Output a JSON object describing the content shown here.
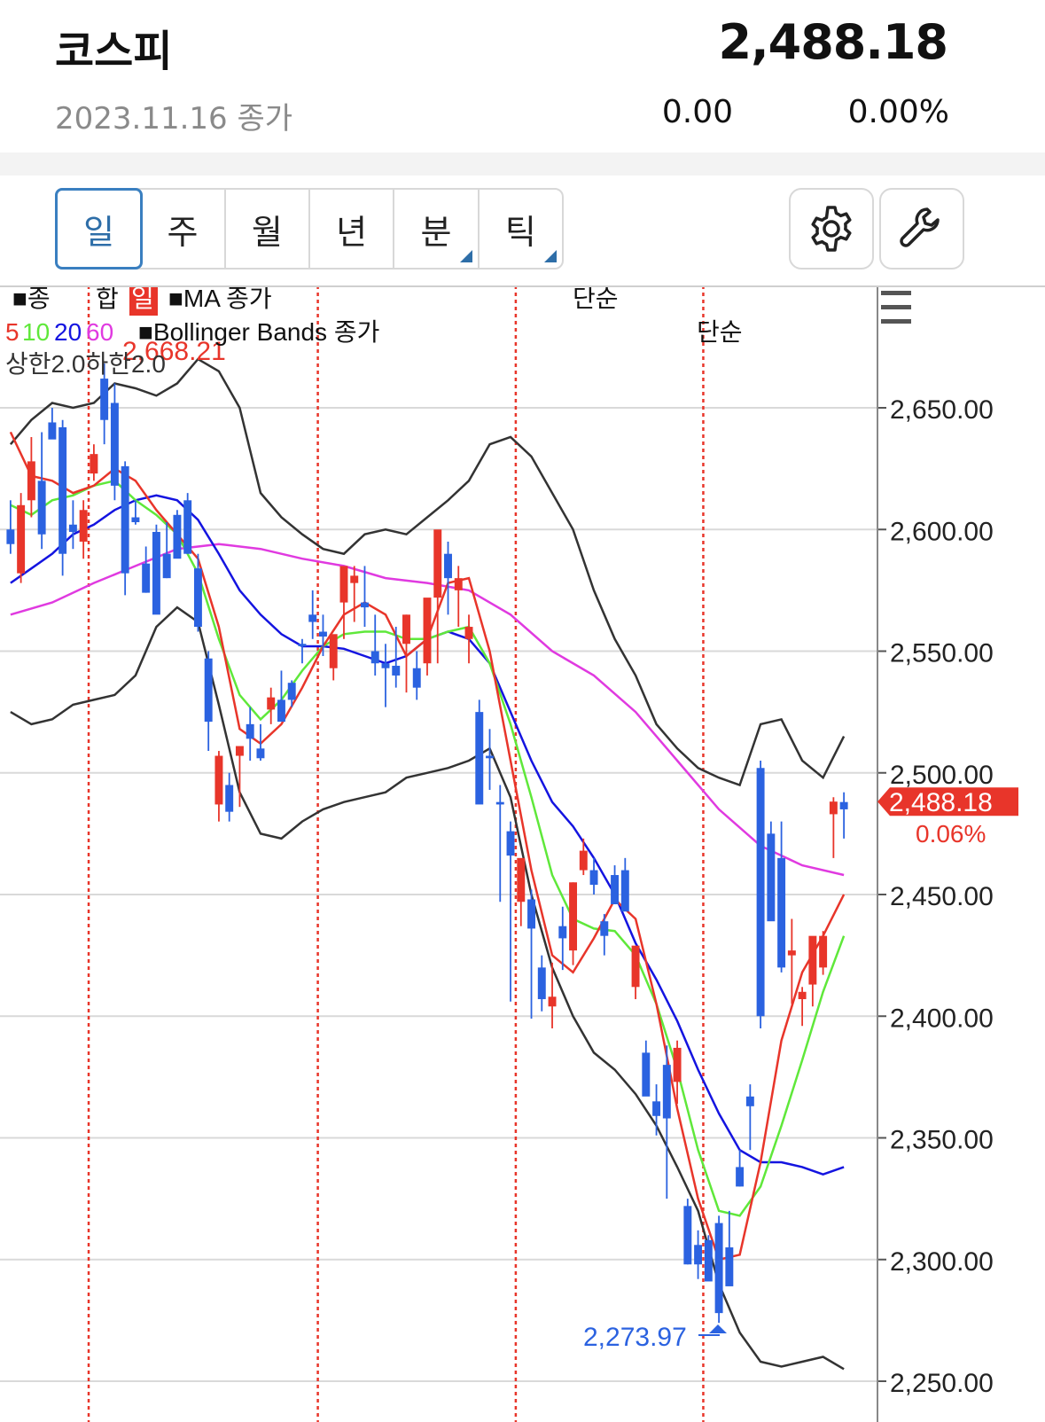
{
  "header": {
    "title": "코스피",
    "price": "2,488.18",
    "date_label": "2023.11.16 종가",
    "change": "0.00",
    "change_pct": "0.00%"
  },
  "period_tabs": [
    {
      "label": "일",
      "active": true,
      "has_submenu": false
    },
    {
      "label": "주",
      "active": false,
      "has_submenu": false
    },
    {
      "label": "월",
      "active": false,
      "has_submenu": false
    },
    {
      "label": "년",
      "active": false,
      "has_submenu": false
    },
    {
      "label": "분",
      "active": false,
      "has_submenu": true
    },
    {
      "label": "틱",
      "active": false,
      "has_submenu": true
    }
  ],
  "tools": {
    "settings_icon": "gear-icon",
    "tools_icon": "wrench-icon",
    "menu_icon": "hamburger-icon"
  },
  "legend": {
    "main_prefix": "■종",
    "main_mid": "합",
    "main_badge": "일",
    "ma_label": "■MA 종가",
    "ma_type": "단순",
    "ma_periods": [
      {
        "label": "5",
        "color": "#e8352a"
      },
      {
        "label": "10",
        "color": "#5fe83a"
      },
      {
        "label": "20",
        "color": "#1414e0"
      },
      {
        "label": "60",
        "color": "#e03ae0"
      }
    ],
    "bb_label": "■Bollinger Bands 종가",
    "bb_type": "단순",
    "bb_params": "상한2.0하한2.0"
  },
  "colors": {
    "up": "#e8352a",
    "down": "#2b62e0",
    "bb": "#333333",
    "ma5": "#e8352a",
    "ma10": "#5fe83a",
    "ma20": "#1414e0",
    "ma60": "#e03ae0",
    "separator": "#e8352a",
    "high_label": "#e8352a",
    "low_label": "#2b62e0"
  },
  "chart_data": {
    "type": "candlestick",
    "y_axis": {
      "min": 2250,
      "max": 2700,
      "ticks": [
        "2,650.00",
        "2,600.00",
        "2,550.00",
        "2,500.00",
        "2,450.00",
        "2,400.00",
        "2,350.00",
        "2,300.00",
        "2,250.00"
      ],
      "tick_values": [
        2650,
        2600,
        2550,
        2500,
        2450,
        2400,
        2350,
        2300,
        2250
      ]
    },
    "high_label": "2,668.21",
    "low_label": "2,273.97",
    "current_value": "2,488.18",
    "current_change_pct": "0.06%",
    "month_separators_after_index": [
      7,
      29,
      48,
      66
    ],
    "ohlc": [
      [
        2600,
        2612,
        2590,
        2594
      ],
      [
        2582,
        2615,
        2578,
        2610
      ],
      [
        2612,
        2638,
        2605,
        2628
      ],
      [
        2620,
        2640,
        2592,
        2598
      ],
      [
        2644,
        2650,
        2638,
        2637
      ],
      [
        2642,
        2645,
        2581,
        2590
      ],
      [
        2602,
        2612,
        2592,
        2599
      ],
      [
        2595,
        2612,
        2588,
        2608
      ],
      [
        2623,
        2635,
        2620,
        2631
      ],
      [
        2662,
        2668.21,
        2635,
        2645
      ],
      [
        2652,
        2660,
        2612,
        2618
      ],
      [
        2626,
        2628,
        2573,
        2582
      ],
      [
        2605,
        2612,
        2602,
        2603
      ],
      [
        2586,
        2593,
        2574,
        2574
      ],
      [
        2599,
        2602,
        2569,
        2565
      ],
      [
        2590,
        2603,
        2580,
        2580
      ],
      [
        2606,
        2608,
        2589,
        2588
      ],
      [
        2612,
        2615,
        2590,
        2590
      ],
      [
        2584,
        2590,
        2558,
        2560
      ],
      [
        2547,
        2550,
        2509,
        2521
      ],
      [
        2487,
        2509,
        2480,
        2507
      ],
      [
        2495,
        2500,
        2480,
        2484
      ],
      [
        2507,
        2510,
        2486,
        2511
      ],
      [
        2520,
        2527,
        2505,
        2514
      ],
      [
        2510,
        2520,
        2505,
        2506
      ],
      [
        2526,
        2535,
        2520,
        2531
      ],
      [
        2530,
        2542,
        2524,
        2521
      ],
      [
        2537,
        2538,
        2527,
        2530
      ],
      [
        2553,
        2555,
        2545,
        2552
      ],
      [
        2565,
        2575,
        2555,
        2562
      ],
      [
        2558,
        2565,
        2548,
        2556
      ],
      [
        2543,
        2555,
        2538,
        2557
      ],
      [
        2570,
        2580,
        2555,
        2585
      ],
      [
        2578,
        2585,
        2562,
        2581
      ],
      [
        2570,
        2585,
        2560,
        2568
      ],
      [
        2550,
        2565,
        2540,
        2545
      ],
      [
        2545,
        2553,
        2527,
        2543
      ],
      [
        2544,
        2560,
        2535,
        2540
      ],
      [
        2553,
        2565,
        2533,
        2565
      ],
      [
        2543,
        2550,
        2530,
        2535
      ],
      [
        2545,
        2565,
        2540,
        2572
      ],
      [
        2572,
        2582,
        2545,
        2600
      ],
      [
        2590,
        2595,
        2565,
        2580
      ],
      [
        2575,
        2585,
        2560,
        2580
      ],
      [
        2555,
        2565,
        2545,
        2560
      ],
      [
        2525,
        2530,
        2493,
        2487
      ],
      [
        2507,
        2518,
        2493,
        2506
      ],
      [
        2488,
        2495,
        2447,
        2487
      ],
      [
        2476,
        2480,
        2406,
        2466
      ],
      [
        2447,
        2460,
        2437,
        2465
      ],
      [
        2448,
        2452,
        2399,
        2436
      ],
      [
        2420,
        2425,
        2402,
        2407
      ],
      [
        2404,
        2422,
        2395,
        2408
      ],
      [
        2437,
        2445,
        2419,
        2432
      ],
      [
        2427,
        2455,
        2421,
        2455
      ],
      [
        2460,
        2473,
        2458,
        2468
      ],
      [
        2460,
        2465,
        2450,
        2454
      ],
      [
        2439,
        2442,
        2425,
        2433
      ],
      [
        2458,
        2462,
        2452,
        2446
      ],
      [
        2460,
        2465,
        2448,
        2443
      ],
      [
        2412,
        2425,
        2407,
        2429
      ],
      [
        2385,
        2390,
        2370,
        2367
      ],
      [
        2365,
        2372,
        2351,
        2359
      ],
      [
        2380,
        2388,
        2325,
        2358
      ],
      [
        2373,
        2390,
        2364,
        2387
      ],
      [
        2322,
        2325,
        2298,
        2298
      ],
      [
        2306,
        2312,
        2292,
        2298
      ],
      [
        2308,
        2310,
        2295,
        2291
      ],
      [
        2315,
        2318,
        2273.97,
        2278
      ],
      [
        2305,
        2320,
        2290,
        2289
      ],
      [
        2338,
        2345,
        2330,
        2330
      ],
      [
        2367,
        2372,
        2345,
        2363
      ],
      [
        2502,
        2505,
        2395,
        2400
      ],
      [
        2475,
        2480,
        2440,
        2439
      ],
      [
        2465,
        2480,
        2418,
        2420
      ],
      [
        2425,
        2440,
        2405,
        2427
      ],
      [
        2407,
        2412,
        2396,
        2410
      ],
      [
        2413,
        2420,
        2404,
        2433
      ],
      [
        2420,
        2435,
        2417,
        2433
      ],
      [
        2483,
        2490,
        2465,
        2488.18
      ],
      [
        2488,
        2492,
        2473,
        2485
      ]
    ],
    "ma5": [
      [
        0,
        2640
      ],
      [
        2,
        2622
      ],
      [
        4,
        2620
      ],
      [
        6,
        2615
      ],
      [
        8,
        2618
      ],
      [
        10,
        2625
      ],
      [
        12,
        2620
      ],
      [
        14,
        2608
      ],
      [
        16,
        2598
      ],
      [
        18,
        2588
      ],
      [
        20,
        2560
      ],
      [
        22,
        2518
      ],
      [
        24,
        2512
      ],
      [
        26,
        2520
      ],
      [
        28,
        2535
      ],
      [
        30,
        2552
      ],
      [
        32,
        2565
      ],
      [
        34,
        2570
      ],
      [
        36,
        2565
      ],
      [
        38,
        2548
      ],
      [
        40,
        2555
      ],
      [
        42,
        2578
      ],
      [
        44,
        2580
      ],
      [
        46,
        2550
      ],
      [
        48,
        2505
      ],
      [
        50,
        2460
      ],
      [
        52,
        2425
      ],
      [
        54,
        2418
      ],
      [
        56,
        2432
      ],
      [
        58,
        2448
      ],
      [
        60,
        2440
      ],
      [
        62,
        2405
      ],
      [
        64,
        2362
      ],
      [
        66,
        2325
      ],
      [
        68,
        2300
      ],
      [
        70,
        2302
      ],
      [
        72,
        2340
      ],
      [
        74,
        2390
      ],
      [
        76,
        2418
      ],
      [
        78,
        2433
      ],
      [
        80,
        2450
      ]
    ],
    "ma10": [
      [
        0,
        2610
      ],
      [
        2,
        2606
      ],
      [
        4,
        2612
      ],
      [
        6,
        2614
      ],
      [
        8,
        2618
      ],
      [
        10,
        2620
      ],
      [
        12,
        2612
      ],
      [
        14,
        2606
      ],
      [
        16,
        2598
      ],
      [
        18,
        2582
      ],
      [
        20,
        2555
      ],
      [
        22,
        2532
      ],
      [
        24,
        2522
      ],
      [
        26,
        2530
      ],
      [
        28,
        2542
      ],
      [
        30,
        2552
      ],
      [
        32,
        2557
      ],
      [
        34,
        2558
      ],
      [
        36,
        2558
      ],
      [
        38,
        2555
      ],
      [
        40,
        2555
      ],
      [
        42,
        2558
      ],
      [
        44,
        2560
      ],
      [
        46,
        2545
      ],
      [
        48,
        2520
      ],
      [
        50,
        2490
      ],
      [
        52,
        2458
      ],
      [
        54,
        2440
      ],
      [
        56,
        2436
      ],
      [
        58,
        2435
      ],
      [
        60,
        2425
      ],
      [
        62,
        2405
      ],
      [
        64,
        2378
      ],
      [
        66,
        2345
      ],
      [
        68,
        2320
      ],
      [
        70,
        2318
      ],
      [
        72,
        2330
      ],
      [
        74,
        2355
      ],
      [
        76,
        2382
      ],
      [
        78,
        2410
      ],
      [
        80,
        2433
      ]
    ],
    "ma20": [
      [
        0,
        2578
      ],
      [
        2,
        2584
      ],
      [
        4,
        2590
      ],
      [
        6,
        2598
      ],
      [
        8,
        2602
      ],
      [
        10,
        2608
      ],
      [
        12,
        2612
      ],
      [
        14,
        2614
      ],
      [
        16,
        2612
      ],
      [
        18,
        2604
      ],
      [
        20,
        2590
      ],
      [
        22,
        2575
      ],
      [
        24,
        2565
      ],
      [
        26,
        2557
      ],
      [
        28,
        2552
      ],
      [
        30,
        2552
      ],
      [
        32,
        2551
      ],
      [
        34,
        2548
      ],
      [
        36,
        2545
      ],
      [
        38,
        2548
      ],
      [
        40,
        2555
      ],
      [
        42,
        2558
      ],
      [
        44,
        2555
      ],
      [
        46,
        2545
      ],
      [
        48,
        2525
      ],
      [
        50,
        2505
      ],
      [
        52,
        2488
      ],
      [
        54,
        2478
      ],
      [
        56,
        2465
      ],
      [
        58,
        2450
      ],
      [
        60,
        2430
      ],
      [
        62,
        2415
      ],
      [
        64,
        2398
      ],
      [
        66,
        2378
      ],
      [
        68,
        2360
      ],
      [
        70,
        2345
      ],
      [
        72,
        2340
      ],
      [
        74,
        2340
      ],
      [
        76,
        2338
      ],
      [
        78,
        2335
      ],
      [
        80,
        2338
      ]
    ],
    "ma60": [
      [
        0,
        2565
      ],
      [
        4,
        2570
      ],
      [
        8,
        2578
      ],
      [
        12,
        2585
      ],
      [
        16,
        2592
      ],
      [
        20,
        2594
      ],
      [
        24,
        2592
      ],
      [
        28,
        2588
      ],
      [
        32,
        2585
      ],
      [
        36,
        2580
      ],
      [
        40,
        2578
      ],
      [
        44,
        2575
      ],
      [
        48,
        2565
      ],
      [
        52,
        2550
      ],
      [
        56,
        2540
      ],
      [
        60,
        2525
      ],
      [
        64,
        2505
      ],
      [
        68,
        2485
      ],
      [
        72,
        2470
      ],
      [
        76,
        2462
      ],
      [
        80,
        2458
      ]
    ],
    "bb_upper": [
      [
        0,
        2635
      ],
      [
        2,
        2645
      ],
      [
        4,
        2652
      ],
      [
        6,
        2650
      ],
      [
        8,
        2652
      ],
      [
        10,
        2660
      ],
      [
        12,
        2658
      ],
      [
        14,
        2655
      ],
      [
        16,
        2660
      ],
      [
        18,
        2670
      ],
      [
        20,
        2665
      ],
      [
        22,
        2650
      ],
      [
        24,
        2615
      ],
      [
        26,
        2605
      ],
      [
        28,
        2598
      ],
      [
        30,
        2592
      ],
      [
        32,
        2590
      ],
      [
        34,
        2598
      ],
      [
        36,
        2600
      ],
      [
        38,
        2598
      ],
      [
        40,
        2605
      ],
      [
        42,
        2612
      ],
      [
        44,
        2620
      ],
      [
        46,
        2635
      ],
      [
        48,
        2638
      ],
      [
        50,
        2630
      ],
      [
        52,
        2615
      ],
      [
        54,
        2600
      ],
      [
        56,
        2575
      ],
      [
        58,
        2555
      ],
      [
        60,
        2540
      ],
      [
        62,
        2520
      ],
      [
        64,
        2510
      ],
      [
        66,
        2502
      ],
      [
        68,
        2498
      ],
      [
        70,
        2495
      ],
      [
        72,
        2520
      ],
      [
        74,
        2522
      ],
      [
        76,
        2505
      ],
      [
        78,
        2498
      ],
      [
        80,
        2515
      ]
    ],
    "bb_lower": [
      [
        0,
        2525
      ],
      [
        2,
        2520
      ],
      [
        4,
        2522
      ],
      [
        6,
        2528
      ],
      [
        8,
        2530
      ],
      [
        10,
        2532
      ],
      [
        12,
        2540
      ],
      [
        14,
        2560
      ],
      [
        16,
        2568
      ],
      [
        18,
        2562
      ],
      [
        20,
        2528
      ],
      [
        22,
        2492
      ],
      [
        24,
        2475
      ],
      [
        26,
        2473
      ],
      [
        28,
        2480
      ],
      [
        30,
        2485
      ],
      [
        32,
        2488
      ],
      [
        34,
        2490
      ],
      [
        36,
        2492
      ],
      [
        38,
        2498
      ],
      [
        40,
        2500
      ],
      [
        42,
        2502
      ],
      [
        44,
        2505
      ],
      [
        46,
        2510
      ],
      [
        48,
        2490
      ],
      [
        50,
        2450
      ],
      [
        52,
        2420
      ],
      [
        54,
        2400
      ],
      [
        56,
        2385
      ],
      [
        58,
        2378
      ],
      [
        60,
        2368
      ],
      [
        62,
        2355
      ],
      [
        64,
        2338
      ],
      [
        66,
        2320
      ],
      [
        68,
        2290
      ],
      [
        70,
        2270
      ],
      [
        72,
        2258
      ],
      [
        74,
        2256
      ],
      [
        76,
        2258
      ],
      [
        78,
        2260
      ],
      [
        80,
        2255
      ]
    ]
  }
}
